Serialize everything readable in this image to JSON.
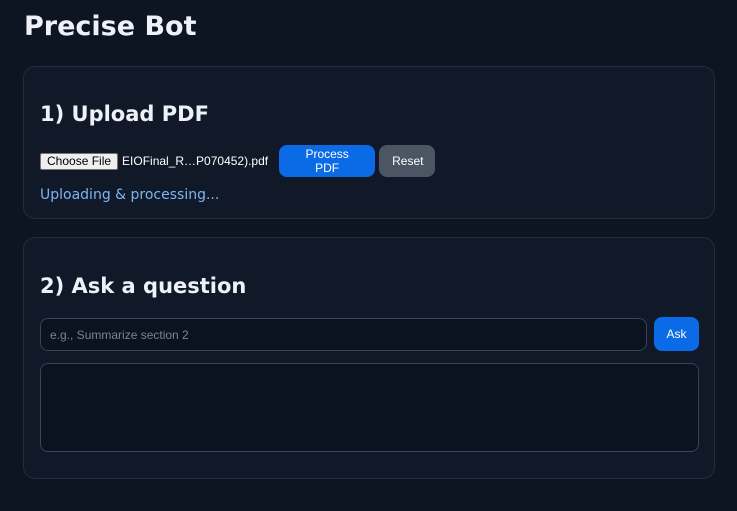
{
  "app": {
    "title": "Precise Bot"
  },
  "upload": {
    "heading": "1) Upload PDF",
    "choose_file_label": "Choose File",
    "file_name": "EIOFinal_R…P070452).pdf",
    "process_label": "Process PDF",
    "reset_label": "Reset",
    "status": "Uploading & processing..."
  },
  "ask": {
    "heading": "2) Ask a question",
    "input_placeholder": "e.g., Summarize section 2",
    "input_value": "",
    "ask_label": "Ask",
    "answer": ""
  },
  "colors": {
    "background": "#0d1422",
    "card": "#111827",
    "primary": "#0b6be6",
    "secondary": "#4b5563",
    "status": "#7cb6f2"
  }
}
